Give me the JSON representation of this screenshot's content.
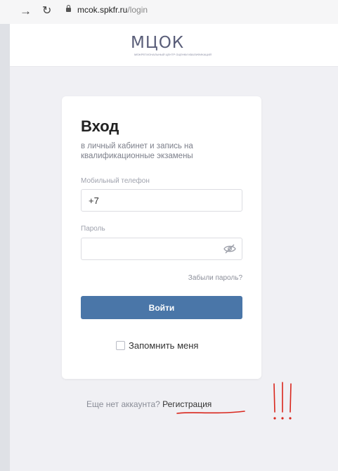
{
  "browser": {
    "url_host": "mcok.spkfr.ru",
    "url_path": "/login"
  },
  "header": {
    "logo_text": "МЦОК",
    "logo_subtitle": "МЕЖРЕГИОНАЛЬНЫЙ ЦЕНТР ОЦЕНКИ КВАЛИФИКАЦИЙ"
  },
  "login": {
    "title": "Вход",
    "subtitle": "в личный кабинет и запись на квалификационные экзамены",
    "phone_label": "Мобильный телефон",
    "phone_value": "+7",
    "password_label": "Пароль",
    "password_value": "",
    "forgot_label": "Забыли пароль?",
    "submit_label": "Войти",
    "remember_label": "Запомнить меня"
  },
  "signup": {
    "prompt": "Еще нет аккаунта?",
    "link_label": "Регистрация"
  },
  "colors": {
    "accent": "#4a76a8",
    "annotation": "#d9261c"
  }
}
